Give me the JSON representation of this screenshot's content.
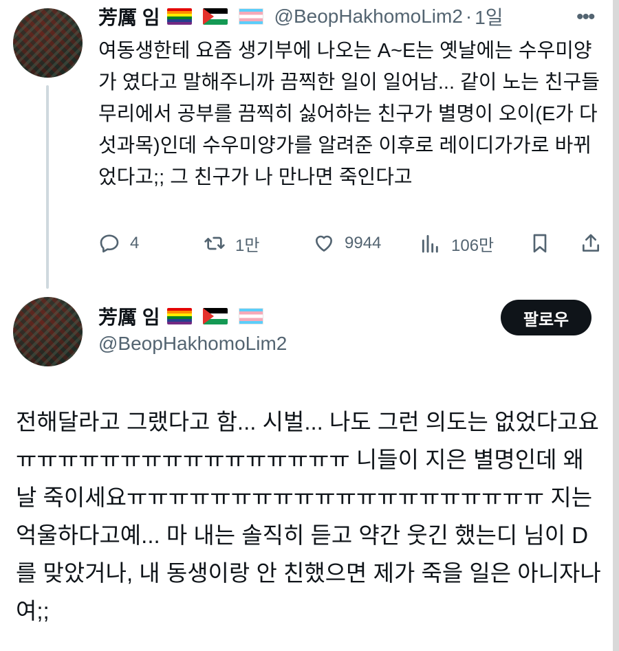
{
  "tweet": {
    "author_name": "芳厲 임",
    "handle": "@BeopHakhomoLim2",
    "separator": "·",
    "time": "1일",
    "more_label": "•••",
    "body": "여동생한테 요즘 생기부에 나오는 A~E는 옛날에는 수우미양가 였다고 말해주니까 끔찍한 일이 일어남... 같이 노는 친구들 무리에서 공부를 끔찍히 싫어하는 친구가 별명이 오이(E가 다섯과목)인데 수우미양가를 알려준 이후로 레이디가가로 바뀌었다고;; 그 친구가 나 만나면 죽인다고",
    "actions": {
      "replies": "4",
      "retweets": "1만",
      "likes": "9944",
      "views": "106만"
    }
  },
  "reply": {
    "author_name": "芳厲 임",
    "handle": "@BeopHakhomoLim2",
    "follow_label": "팔로우",
    "body": "전해달라고 그랬다고 함... 시벌... 나도 그런 의도는 없었다고요ㅠㅠㅠㅠㅠㅠㅠㅠㅠㅠㅠㅠㅠㅠㅠㅠ 니들이 지은 별명인데 왜 날 죽이세요ㅠㅠㅠㅠㅠㅠㅠㅠㅠㅠㅠㅠㅠㅠㅠㅠㅠㅠㅠㅠ 지는 억울하다고예... 마 내는 솔직히 듣고 약간 웃긴 했는디 님이 D를 맞았거나, 내 동생이랑 안 친했으면 제가 죽을 일은 아니자나여;;"
  },
  "flags": [
    "rainbow-flag-icon",
    "palestine-flag-icon",
    "transgender-flag-icon"
  ],
  "colors": {
    "text": "#0f1419",
    "secondary": "#536471",
    "thread_line": "#cfd9de",
    "follow_bg": "#0f1419"
  }
}
